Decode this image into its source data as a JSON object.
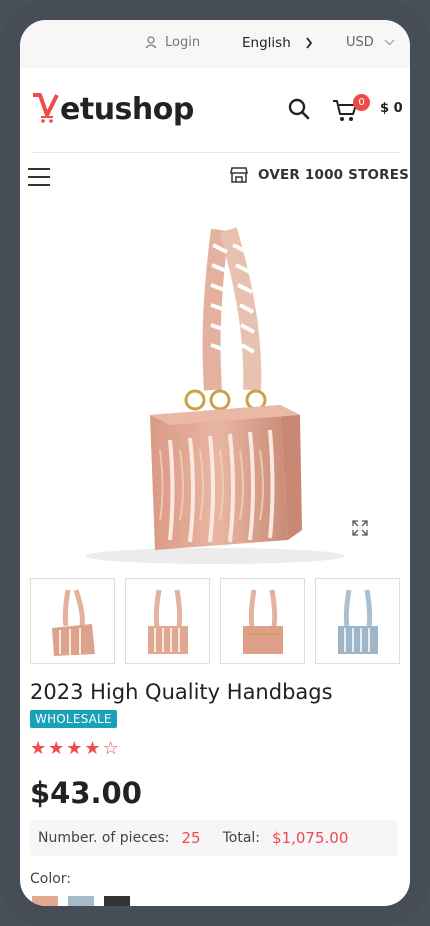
{
  "topbar": {
    "login_label": "Login",
    "language": "English",
    "currency": "USD"
  },
  "header": {
    "logo_text_rest": "etushop",
    "cart_count": "0",
    "cart_total": "$ 0"
  },
  "nav": {
    "stores_label": "OVER 1000 STORES"
  },
  "product": {
    "title": "2023 High Quality Handbags",
    "badge": "WHOLESALE",
    "rating": 4,
    "rating_max": 5,
    "price": "$43.00",
    "pieces_label": "Number. of pieces:",
    "pieces_value": "25",
    "total_label": "Total:",
    "total_value": "$1,075.00",
    "color_label": "Color:",
    "colors": [
      "#e3aa93",
      "#a8bbc9",
      "#333333"
    ]
  },
  "accent_color": "#ef4b4b"
}
